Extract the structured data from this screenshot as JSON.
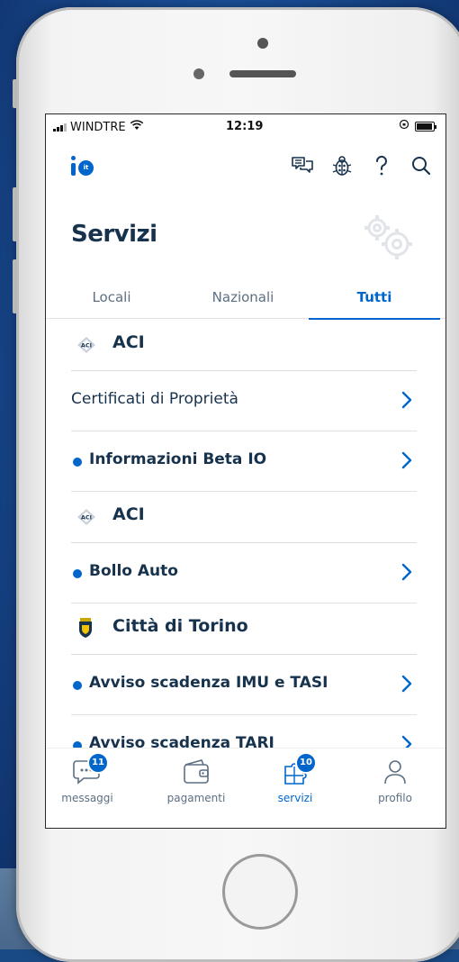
{
  "status_bar": {
    "carrier": "WINDTRE",
    "time": "12:19"
  },
  "header": {
    "logo_text": "it"
  },
  "page": {
    "title": "Servizi"
  },
  "tabs": [
    {
      "label": "Locali",
      "active": false
    },
    {
      "label": "Nazionali",
      "active": false
    },
    {
      "label": "Tutti",
      "active": true
    }
  ],
  "sections": [
    {
      "org": "ACI",
      "items": [
        {
          "label": "Certificati di Proprietà",
          "unread": false
        },
        {
          "label": "Informazioni Beta IO",
          "unread": true
        }
      ]
    },
    {
      "org": "ACI",
      "items": [
        {
          "label": "Bollo Auto",
          "unread": true
        }
      ]
    },
    {
      "org": "Città di Torino",
      "items": [
        {
          "label": "Avviso scadenza IMU e TASI",
          "unread": true
        },
        {
          "label": "Avviso scadenza TARI",
          "unread": true
        }
      ]
    }
  ],
  "bottom_nav": [
    {
      "label": "messaggi",
      "badge": "11",
      "active": false
    },
    {
      "label": "pagamenti",
      "badge": "",
      "active": false
    },
    {
      "label": "servizi",
      "badge": "10",
      "active": true
    },
    {
      "label": "profilo",
      "badge": "",
      "active": false
    }
  ],
  "colors": {
    "accent": "#0066cc",
    "text": "#17324d",
    "muted": "#5c6f82"
  }
}
